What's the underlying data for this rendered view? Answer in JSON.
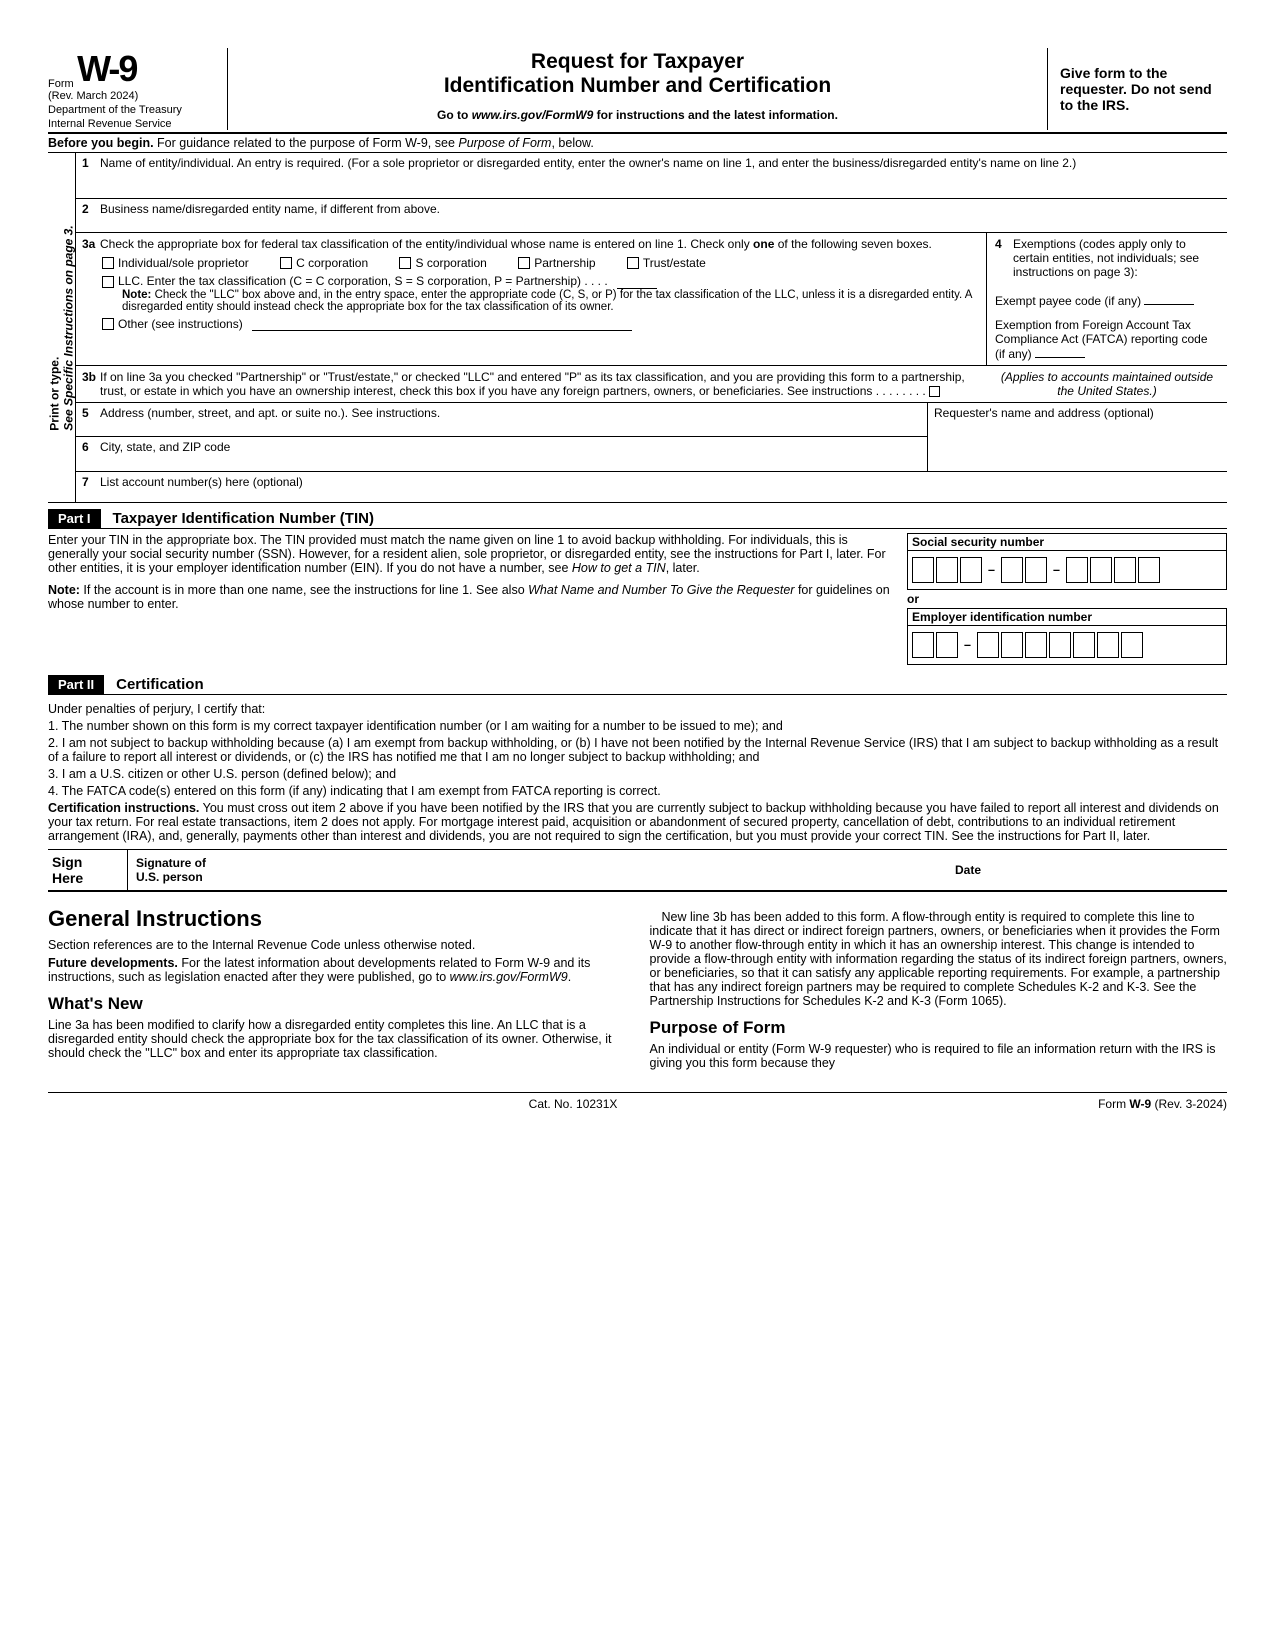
{
  "header": {
    "form_word": "Form",
    "form_number": "W-9",
    "revision": "(Rev. March 2024)",
    "dept1": "Department of the Treasury",
    "dept2": "Internal Revenue Service",
    "title_line1": "Request for Taxpayer",
    "title_line2": "Identification Number and Certification",
    "goto_prefix": "Go to ",
    "goto_link": "www.irs.gov/FormW9",
    "goto_suffix": " for instructions and the latest information.",
    "right_text": "Give form to the requester. Do not send to the IRS."
  },
  "before_begin": {
    "bold": "Before you begin.",
    "text": " For guidance related to the purpose of Form W-9, see ",
    "italic": "Purpose of Form",
    "suffix": ", below."
  },
  "vertical": {
    "line1": "Print or type.",
    "line2": "See Specific Instructions on page 3."
  },
  "fields": {
    "f1_num": "1",
    "f1": "Name of entity/individual. An entry is required. (For a sole proprietor or disregarded entity, enter the owner's name on line 1, and enter the business/disregarded entity's name on line 2.)",
    "f2_num": "2",
    "f2": "Business name/disregarded entity name, if different from above.",
    "f3a_num": "3a",
    "f3a_intro1": "Check the appropriate box for federal tax classification of the entity/individual whose name is entered on line 1. Check only ",
    "f3a_bold": "one",
    "f3a_intro2": " of the following seven boxes.",
    "chk_ind": "Individual/sole proprietor",
    "chk_c": "C corporation",
    "chk_s": "S corporation",
    "chk_p": "Partnership",
    "chk_t": "Trust/estate",
    "chk_llc": "LLC. Enter the tax classification (C = C corporation, S = S corporation, P = Partnership)   .    .    .    .",
    "note_bold": "Note:",
    "note_text": " Check the \"LLC\" box above and, in the entry space, enter the appropriate code (C, S, or P) for the tax classification of the LLC, unless it is a disregarded entity. A disregarded entity should instead check the appropriate box for the tax classification of its owner.",
    "chk_other": "Other (see instructions)",
    "f4_num": "4",
    "f4_text1": "Exemptions (codes apply only to certain entities, not individuals; see instructions on page 3):",
    "f4_text2": "Exempt payee code (if any)",
    "f4_text3": "Exemption from Foreign Account Tax Compliance Act (FATCA) reporting code (if any)",
    "f3b_num": "3b",
    "f3b_text": "If on line 3a you checked \"Partnership\" or \"Trust/estate,\" or checked \"LLC\" and entered \"P\" as its tax classification, and you are providing this form to a partnership, trust, or estate in which you have an ownership interest, check this box if you have any foreign partners, owners, or beneficiaries. See instructions   .     .     .     .     .     .     .     .",
    "f3b_right": "(Applies to accounts maintained outside the United States.)",
    "f5_num": "5",
    "f5": "Address (number, street, and apt. or suite no.). See instructions.",
    "f5_right": "Requester's name and address (optional)",
    "f6_num": "6",
    "f6": "City, state, and ZIP code",
    "f7_num": "7",
    "f7": "List account number(s) here (optional)"
  },
  "part1": {
    "label": "Part I",
    "title": "Taxpayer Identification Number (TIN)",
    "p1a": "Enter your TIN in the appropriate box. The TIN provided must match the name given on line 1 to avoid backup withholding. For individuals, this is generally your social security number (SSN). However, for a resident alien, sole proprietor, or disregarded entity, see the instructions for Part I, later. For other entities, it is your employer identification number (EIN). If you do not have a number, see ",
    "p1a_italic": "How to get a TIN",
    "p1a_suffix": ", later.",
    "p1b_bold": "Note:",
    "p1b": " If the account is in more than one name, see the instructions for line 1. See also ",
    "p1b_italic": "What Name and Number To Give the Requester",
    "p1b_suffix": " for guidelines on whose number to enter.",
    "ssn_label": "Social security number",
    "or": "or",
    "ein_label": "Employer identification number"
  },
  "part2": {
    "label": "Part II",
    "title": "Certification",
    "intro": "Under penalties of perjury, I certify that:",
    "c1": "1. The number shown on this form is my correct taxpayer identification number (or I am waiting for a number to be issued to me); and",
    "c2": "2. I am not subject to backup withholding because (a) I am exempt from backup withholding, or (b) I have not been notified by the Internal Revenue Service (IRS) that I am subject to backup withholding as a result of a failure to report all interest or dividends, or (c) the IRS has notified me that I am no longer subject to backup withholding; and",
    "c3": "3. I am a U.S. citizen or other U.S. person (defined below); and",
    "c4": "4. The FATCA code(s) entered on this form (if any) indicating that I am exempt from FATCA reporting is correct.",
    "ci_bold": "Certification instructions.",
    "ci": " You must cross out item 2 above if you have been notified by the IRS that you are currently subject to backup withholding because you have failed to report all interest and dividends on your tax return. For real estate transactions, item 2 does not apply. For mortgage interest paid, acquisition or abandonment of secured property, cancellation of debt, contributions to an individual retirement arrangement (IRA), and, generally, payments other than interest and dividends, you are not required to sign the certification, but you must provide your correct TIN. See the instructions for Part II, later."
  },
  "sign": {
    "left1": "Sign",
    "left2": "Here",
    "mid1": "Signature of",
    "mid2": "U.S. person",
    "date": "Date"
  },
  "instructions": {
    "gi_title": "General Instructions",
    "gi_p1": "Section references are to the Internal Revenue Code unless otherwise noted.",
    "gi_fd_bold": "Future developments.",
    "gi_fd": " For the latest information about developments related to Form W-9 and its instructions, such as legislation enacted after they were published, go to ",
    "gi_fd_link": "www.irs.gov/FormW9",
    "gi_fd_suffix": ".",
    "wn_title": "What's New",
    "wn_p1": "Line 3a has been modified to clarify how a disregarded entity completes this line. An LLC that is a disregarded entity should check the appropriate box for the tax classification of its owner. Otherwise, it should check the \"LLC\" box and enter its appropriate tax classification.",
    "col2_p1": "New line 3b has been added to this form. A flow-through entity is required to complete this line to indicate that it has direct or indirect foreign partners, owners, or beneficiaries when it provides the Form W-9 to another flow-through entity in which it has an ownership interest. This change is intended to provide a flow-through entity with information regarding the status of its indirect foreign partners, owners, or beneficiaries, so that it can satisfy any applicable reporting requirements. For example, a partnership that has any indirect foreign partners may be required to complete Schedules K-2 and K-3. See the Partnership Instructions for Schedules K-2 and K-3 (Form 1065).",
    "pf_title": "Purpose of Form",
    "pf_p1": "An individual or entity (Form W-9 requester) who is required to file an information return with the IRS is giving you this form because they"
  },
  "footer": {
    "cat": "Cat. No. 10231X",
    "right_prefix": "Form ",
    "right_bold": "W-9",
    "right_suffix": " (Rev. 3-2024)"
  }
}
